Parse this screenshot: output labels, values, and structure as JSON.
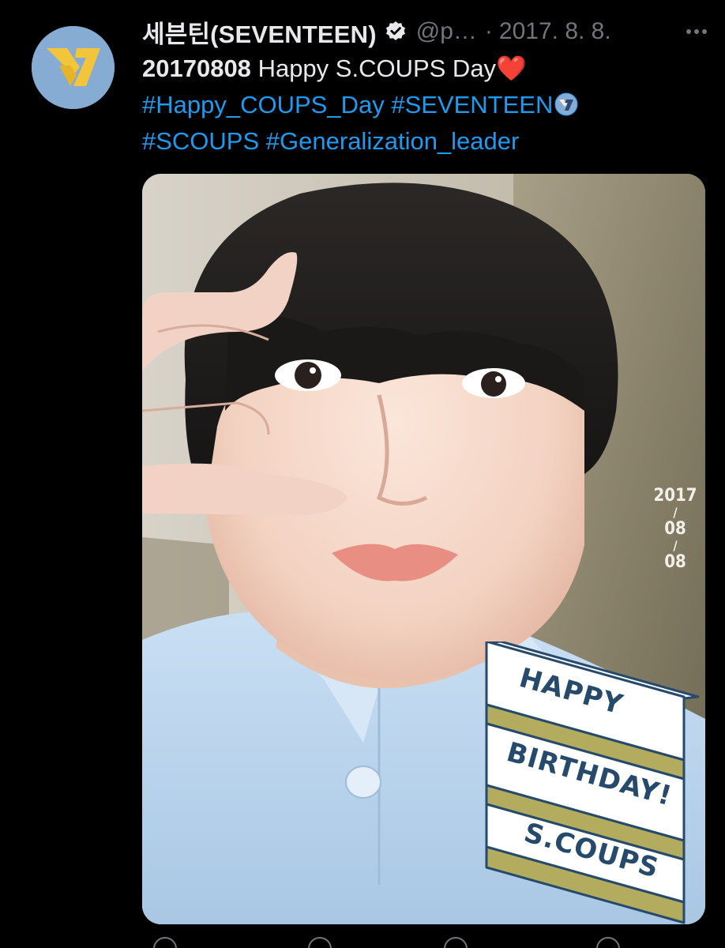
{
  "tweet": {
    "author": {
      "display_name": "세븐틴(SEVENTEEN)",
      "handle": "@p…",
      "verified_icon": "verified-badge-icon",
      "avatar_icon": "seventeen-logo-icon",
      "avatar_color": "#86acd4"
    },
    "separator": "·",
    "date": "2017. 8. 8.",
    "more_icon": "more-dots-icon",
    "text": {
      "date_code": "20170808",
      "title": "Happy S.COUPS Day",
      "heart_emoji": "❤️",
      "hashtags_line1": [
        "#Happy_COUPS_Day",
        "#SEVENTEEN"
      ],
      "hashtags_line2": [
        "#SCOUPS",
        "#Generalization_leader"
      ],
      "hashtag_color": "#1d9bf0"
    },
    "media": {
      "date_stamp": {
        "year": "2017",
        "month": "08",
        "day": "08",
        "slash": "/"
      },
      "sticker": {
        "line1": "HAPPY",
        "line2": "BIRTHDAY!",
        "line3": "S.COUPS",
        "face_color": "#ffffff",
        "side_color": "#b3ab5d",
        "text_color": "#264a6b"
      }
    }
  }
}
